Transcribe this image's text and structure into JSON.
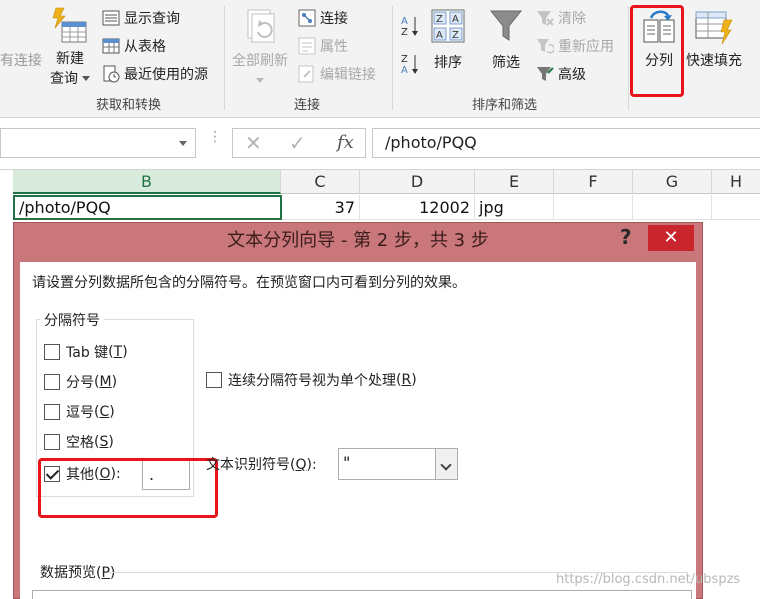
{
  "ribbon": {
    "get_transform": {
      "connections_partial": "有连接",
      "new_query_line1": "新建",
      "new_query_line2": "查询",
      "show_queries": "显示查询",
      "from_table": "从表格",
      "recent_sources": "最近使用的源",
      "group_label": "获取和转换"
    },
    "connections": {
      "refresh_all": "全部刷新",
      "connections": "连接",
      "properties": "属性",
      "edit_links": "编辑链接",
      "group_label": "连接"
    },
    "sort_filter": {
      "sort": "排序",
      "filter": "筛选",
      "clear": "清除",
      "reapply": "重新应用",
      "advanced": "高级",
      "group_label": "排序和筛选"
    },
    "data_tools": {
      "text_to_columns": "分列",
      "flash_fill": "快速填充"
    }
  },
  "formula_bar": {
    "cancel": "✕",
    "enter": "✓",
    "fx": "fx",
    "formula": "/photo/PQQ"
  },
  "sheet": {
    "columns": [
      "B",
      "C",
      "D",
      "E",
      "F",
      "G",
      "H"
    ],
    "row": {
      "b": "/photo/PQQ",
      "c": "37",
      "d": "12002",
      "e": "jpg"
    }
  },
  "dialog": {
    "title": "文本分列向导 - 第 2 步，共 3 步",
    "help": "?",
    "close": "✕",
    "description": "请设置分列数据所包含的分隔符号。在预览窗口内可看到分列的效果。",
    "delimiters_legend": "分隔符号",
    "options": {
      "tab": {
        "label": "Tab 键",
        "key": "T",
        "checked": false
      },
      "semicolon": {
        "label": "分号",
        "key": "M",
        "checked": false
      },
      "comma": {
        "label": "逗号",
        "key": "C",
        "checked": false
      },
      "space": {
        "label": "空格",
        "key": "S",
        "checked": false
      },
      "other": {
        "label": "其他",
        "key": "O",
        "checked": true,
        "value": "."
      }
    },
    "consecutive": {
      "label": "连续分隔符号视为单个处理",
      "key": "R",
      "checked": false
    },
    "text_qualifier": {
      "label": "文本识别符号",
      "key": "Q",
      "value": "\""
    },
    "preview": {
      "label": "数据预览",
      "key": "P"
    }
  },
  "watermark": "https://blog.csdn.net/ubspzs",
  "colors": {
    "accent_green": "#217346",
    "highlight_red": "#e8131b",
    "dialog_title": "#c9777a",
    "close_red": "#c8262c"
  }
}
